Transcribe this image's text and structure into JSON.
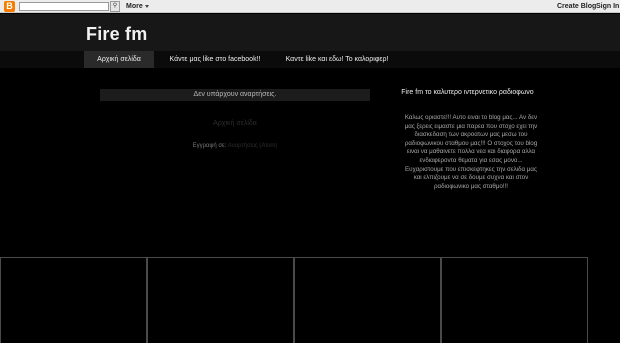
{
  "navbar": {
    "logo_letter": "B",
    "more_label": "More",
    "create_blog_label": "Create Blog",
    "sign_in_label": "Sign In"
  },
  "blog": {
    "title": "Fire fm"
  },
  "tabs": [
    {
      "label": "Αρχική σελίδα"
    },
    {
      "label": "Κάντε μας like στο facebook!!"
    },
    {
      "label": "Καντε like και εδω! Το καλοριφερ!"
    }
  ],
  "main": {
    "no_posts_text": "Δεν υπάρχουν αναρτήσεις.",
    "home_link_label": "Αρχική σελίδα",
    "subscribe_prefix": "Εγγραφή σε:",
    "subscribe_link_label": "Αναρτήσεις (Atom)"
  },
  "sidebar": {
    "title": "Fire fm το καλυτερο ιντερνετικο ραδιοφωνο",
    "text": "Καλως οριαστε!!! Αυτο ειναι το blog μας... Αν δεν μας ξερεις ειμαστε μια παρεα που στοχο εχει την διασκεδαση των ακροατων μας μεσω του ραδιοφωνικου σταθμου μας!!! Ο στοχος του blog ειναι να μαθαινετε πολλα νεα και διαφορα αλλα ενδιαφεροντα θεματα για εσας μονο... Ευχαριστουμε που επισκεφτηκες την σελιδα μας και ελπιζουμε να σε δουμε συχνα και στον ραδιοφωνικο μας σταθμο!!!"
  },
  "colors": {
    "background": "#000000",
    "header_band": "#171717",
    "tab_active": "#2a2a2a",
    "navbar": "#ececec",
    "blogger_orange": "#f57d00"
  }
}
